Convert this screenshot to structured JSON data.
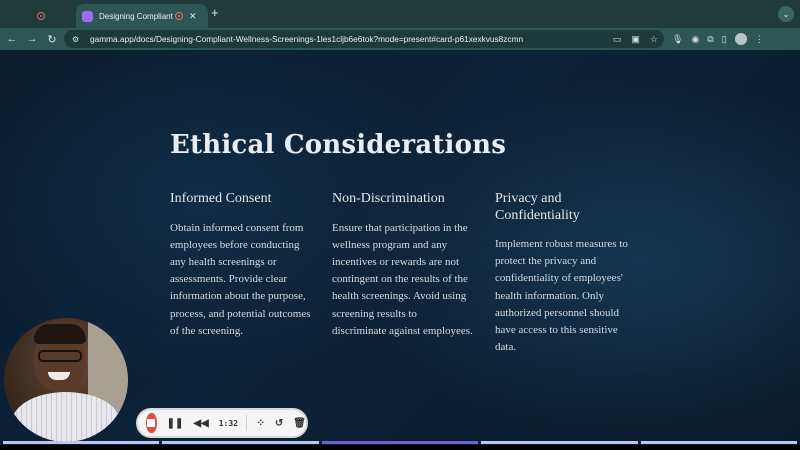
{
  "browser": {
    "tabs": [
      {
        "title": "",
        "recording_indicator": true
      },
      {
        "title": "Designing Compliant Wel",
        "favicon": "gamma-icon",
        "recording_indicator": true,
        "active": true
      }
    ],
    "new_tab_symbol": "+",
    "url": "gamma.app/docs/Designing-Compliant-Wellness-Screenings-1les1cljb6e6tok?mode=present#card-p61xexkvus8zcmn"
  },
  "slide": {
    "title": "Ethical Considerations",
    "columns": [
      {
        "heading": "Informed Consent",
        "body": "Obtain informed consent from employees before conducting any health screenings or assessments. Provide clear information about the purpose, process, and potential outcomes of the screening."
      },
      {
        "heading": "Non-Discrimination",
        "body": "Ensure that participation in the wellness program and any incentives or rewards are not contingent on the results of the health screenings. Avoid using screening results to discriminate against employees."
      },
      {
        "heading": "Privacy and Confidentiality",
        "body": "Implement robust measures to protect the privacy and confidentiality of employees' health information. Only authorized personnel should have access to this sensitive data."
      }
    ],
    "progress": {
      "segments": 5,
      "current": 3
    }
  },
  "recorder": {
    "time": "1:32",
    "colors": {
      "stop": "#e84a3c",
      "bar": "#f5f5f5"
    }
  },
  "colors": {
    "accent": "#6c63d9",
    "chrome": "#2e5654",
    "slide_bg": "#0c2238"
  }
}
